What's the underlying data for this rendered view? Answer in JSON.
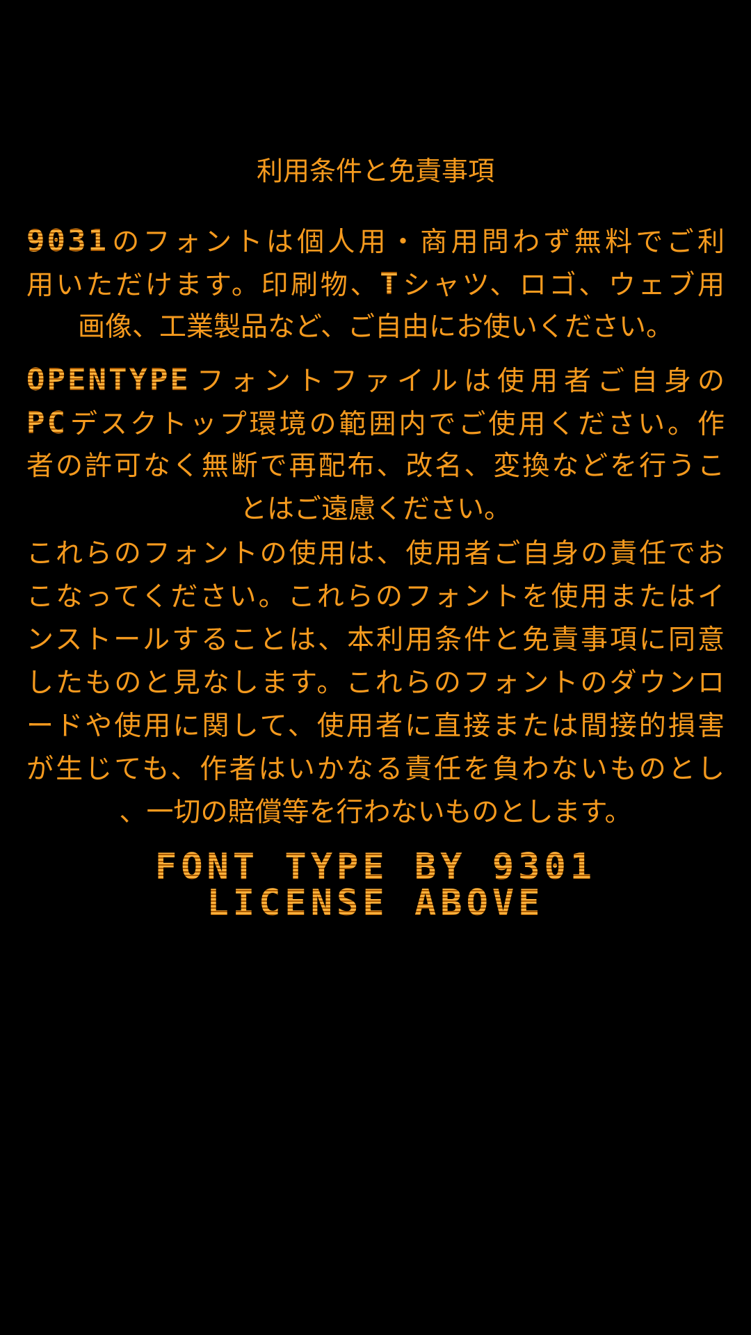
{
  "title": "利用条件と免責事項",
  "paragraph1": {
    "lines": [
      {
        "pre": "",
        "pix": "9031",
        "post": "のフォントは個人用・商用問わず無料でご利"
      },
      {
        "pre": "用いただけます。印刷物、",
        "pix": "T",
        "post": "シャツ、ロゴ、ウェブ用"
      },
      {
        "pre": "画像、工業製品など、ご自由にお使いください。",
        "pix": "",
        "post": ""
      }
    ]
  },
  "paragraph2": {
    "lines": [
      {
        "pre": "",
        "pix": "OPENTYPE",
        "post": "フォントファイルは使用者ご自身の"
      },
      {
        "pre": "",
        "pix": "PC",
        "post": "デスクトップ環境の範囲内でご使用ください。作"
      },
      {
        "pre": "者の許可なく無断で再配布、改名、変換などを行うこ",
        "pix": "",
        "post": ""
      },
      {
        "pre": "とはご遠慮ください。",
        "pix": "",
        "post": ""
      }
    ]
  },
  "paragraph3": {
    "lines": [
      "これらのフォントの使用は、使用者ご自身の責任でお",
      "こなってください。これらのフォントを使用またはイ",
      "ンストールすることは、本利用条件と免責事項に同意",
      "したものと見なします。これらのフォントのダウンロ",
      "ードや使用に関して、使用者に直接または間接的損害",
      "が生じても、作者はいかなる責任を負わないものとし",
      "、一切の賠償等を行わないものとします。"
    ]
  },
  "credits": {
    "line1": "FONT TYPE BY 9301",
    "line2": "LICENSE ABOVE"
  },
  "colors": {
    "text": "#f59a1e",
    "background": "#000000"
  }
}
